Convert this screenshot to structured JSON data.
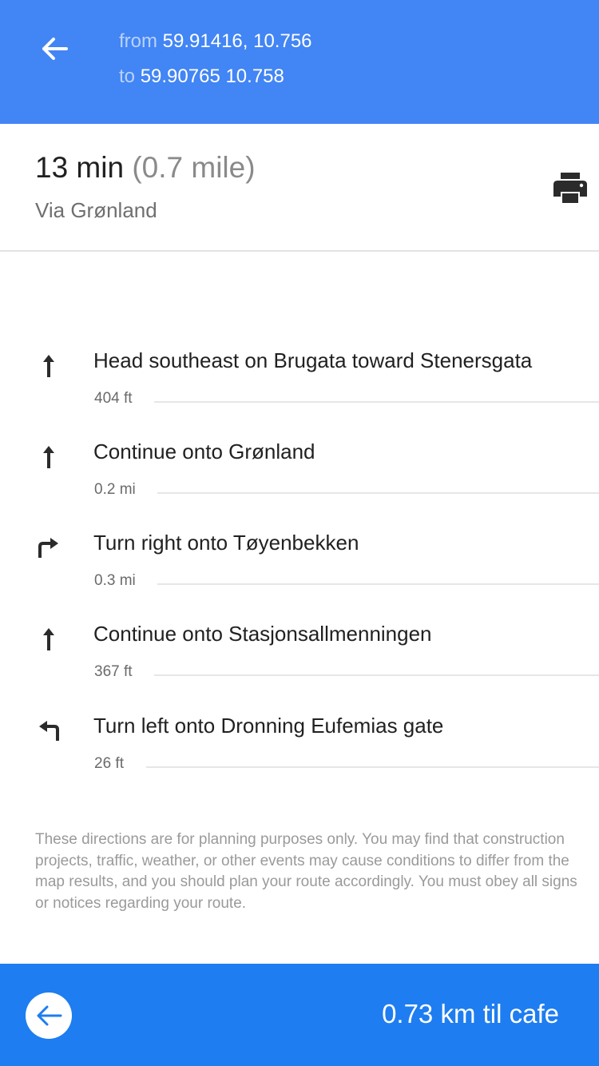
{
  "header": {
    "back_icon": "arrow-left-icon",
    "from_prefix": "from",
    "from_value": "59.91416, 10.756",
    "to_prefix": "to",
    "to_value": "59.90765 10.758",
    "color": "#4285f4"
  },
  "summary": {
    "duration": "13 min",
    "distance": "(0.7 mile)",
    "via": "Via Grønland",
    "print_icon": "printer-icon"
  },
  "steps": [
    {
      "icon": "straight-arrow-icon",
      "text": "Head southeast on Brugata toward Stenersgata",
      "distance": "404 ft"
    },
    {
      "icon": "straight-arrow-icon",
      "text": "Continue onto Grønland",
      "distance": "0.2 mi"
    },
    {
      "icon": "turn-right-icon",
      "text": "Turn right onto Tøyenbekken",
      "distance": "0.3 mi"
    },
    {
      "icon": "straight-arrow-icon",
      "text": "Continue onto Stasjonsallmenningen",
      "distance": "367 ft"
    },
    {
      "icon": "turn-left-icon",
      "text": "Turn left onto Dronning Eufemias gate",
      "distance": "26 ft"
    }
  ],
  "disclaimer": "These directions are for planning purposes only. You may find that construction projects, traffic, weather, or other events may cause conditions to differ from the map results, and you should plan your route accordingly. You must obey all signs or notices regarding your route.",
  "footer": {
    "back_icon": "arrow-left-circle-icon",
    "label": "0.73 km til cafe",
    "color": "#1e7df0"
  }
}
